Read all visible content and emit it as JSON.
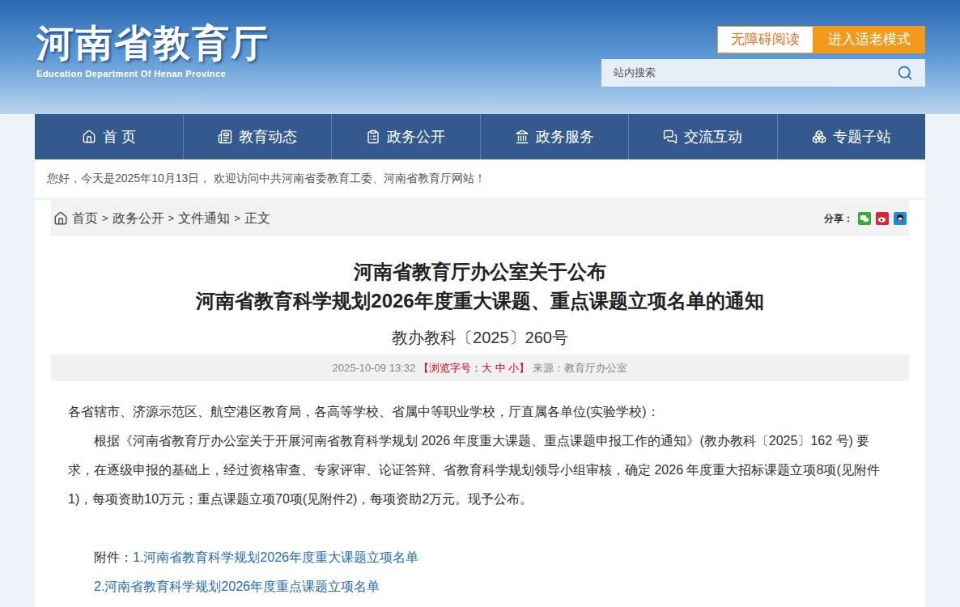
{
  "header": {
    "title": "河南省教育厅",
    "subtitle": "Education Department Of Henan Province",
    "buttons": [
      {
        "label": "无障碍阅读",
        "kind": "outline"
      },
      {
        "label": "进入适老模式",
        "kind": "filled"
      }
    ],
    "search": {
      "placeholder": "站内搜索"
    }
  },
  "nav": {
    "items": [
      {
        "label": "首 页",
        "kind": "home"
      },
      {
        "label": "教育动态",
        "kind": "news"
      },
      {
        "label": "政务公开",
        "kind": "open"
      },
      {
        "label": "政务服务",
        "kind": "service"
      },
      {
        "label": "交流互动",
        "kind": "talk"
      },
      {
        "label": "专题子站",
        "kind": "site"
      }
    ]
  },
  "greeting": "您好，今天是2025年10月13日， 欢迎访问中共河南省委教育工委、河南省教育厅网站！",
  "breadcrumb": {
    "items": [
      "首页",
      "政务公开",
      "文件通知",
      "正文"
    ],
    "separator": ">"
  },
  "share": {
    "label": "分享：",
    "targets": [
      {
        "kind": "wechat",
        "color": "#3aa935"
      },
      {
        "kind": "weibo",
        "color": "#d7263d"
      },
      {
        "kind": "qq",
        "color": "#1a8fd6"
      }
    ]
  },
  "article": {
    "title_lines": [
      "河南省教育厅办公室关于公布",
      "河南省教育科学规划2026年度重大课题、重点课题立项名单的通知"
    ],
    "doc_number": "教办教科〔2025〕260号",
    "meta": {
      "date": "2025-10-09 13:32",
      "font_size": "【浏览字号：大 中 小】",
      "source": "来源：教育厅办公室"
    },
    "salutation": "各省辖市、济源示范区、航空港区教育局，各高等学校、省属中等职业学校，厅直属各单位(实验学校)：",
    "paragraph": "根据《河南省教育厅办公室关于开展河南省教育科学规划 2026 年度重大课题、重点课题申报工作的通知》(教办教科〔2025〕162 号) 要求，在逐级申报的基础上，经过资格审查、专家评审、论证答辩、省教育科学规划领导小组审核，确定 2026 年度重大招标课题立项8项(见附件1)，每项资助10万元；重点课题立项70项(见附件2)，每项资助2万元。现予公布。",
    "attachments_label": "附件：",
    "attachments": [
      "1.河南省教育科学规划2026年度重大课题立项名单",
      "2.河南省教育科学规划2026年度重点课题立项名单"
    ]
  }
}
